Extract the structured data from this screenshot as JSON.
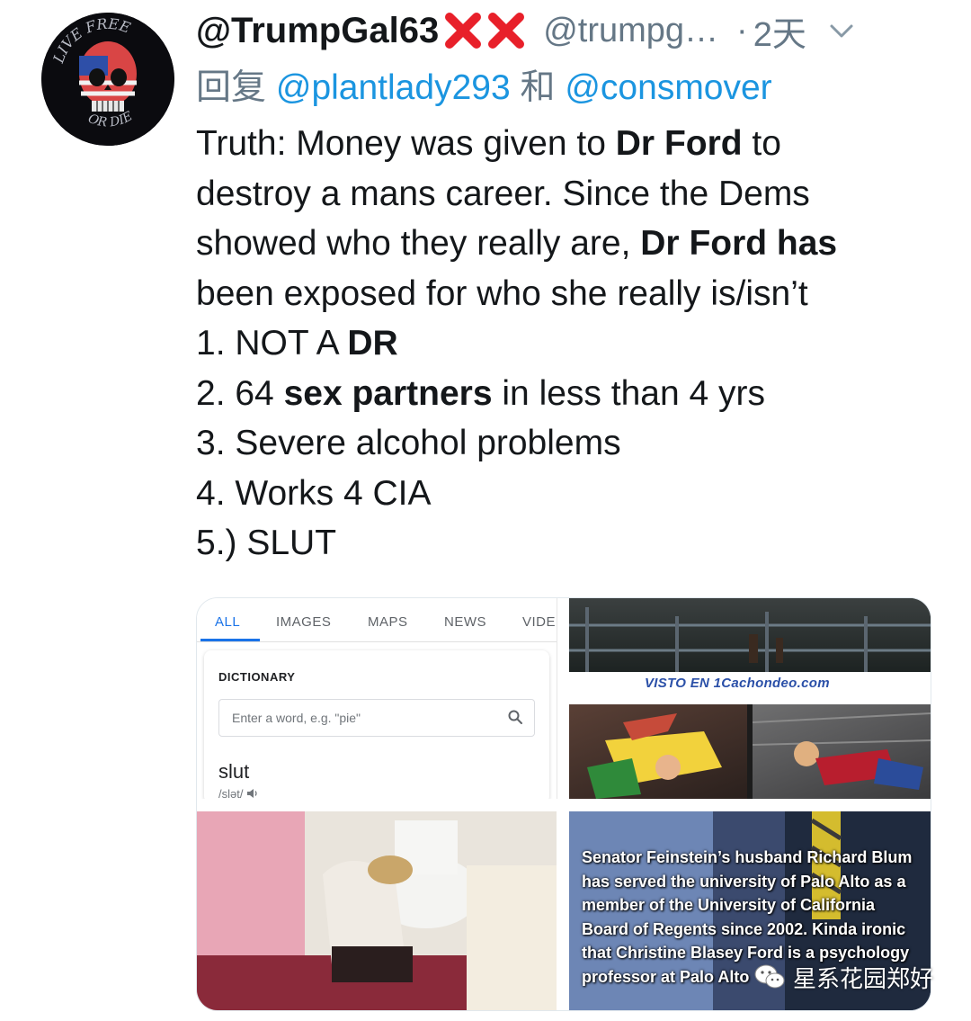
{
  "tweet": {
    "display_name": "@TrumpGal63",
    "handle": "@trumpg…",
    "dot": "·",
    "time": "2天",
    "reply_prefix": "回复",
    "reply_to_1": "@plantlady293",
    "reply_and": "和",
    "reply_to_2": "@consmover",
    "body": {
      "l1a": "Truth:  Money was given to ",
      "l1b": "Dr Ford",
      "l1c": " to",
      "l2": "destroy a mans career. Since the Dems",
      "l3a": "showed who they really are, ",
      "l3b": "Dr Ford has",
      "l4": "been exposed for who she really is/isn’t",
      "l5a": "1. NOT A ",
      "l5b": "DR",
      "l6a": "2. 64 ",
      "l6b": "sex partners",
      "l6c": " in less than 4 yrs",
      "l7": "3.  Severe alcohol problems",
      "l8": "4. Works 4 CIA",
      "l9": "5.) SLUT"
    }
  },
  "avatar": {
    "text_top": "LIVE FREE",
    "text_bottom": "OR DIE"
  },
  "media": {
    "google": {
      "tabs": [
        "ALL",
        "IMAGES",
        "MAPS",
        "NEWS",
        "VIDE"
      ],
      "dictionary_label": "DICTIONARY",
      "search_placeholder": "Enter a word, e.g. \"pie\"",
      "word": "slut",
      "pronunciation": "/slət/"
    },
    "watermark": "VISTO EN  1Cachondeo.com",
    "caption": [
      "Senator Feinstein’s husband Richard Blum",
      "has served the university of Palo Alto as a",
      "member of the University of California",
      "Board of Regents since 2002. Kinda ironic",
      "that Christine Blasey Ford is a psychology",
      "professor at Palo Alto"
    ]
  },
  "source_watermark": "星系花园郑好",
  "colors": {
    "link": "#1b95e0",
    "muted": "#657786",
    "x_red": "#e8202a"
  },
  "icons": [
    "cross-mark-icon",
    "chevron-down-icon",
    "search-icon",
    "speaker-icon",
    "wechat-icon"
  ]
}
